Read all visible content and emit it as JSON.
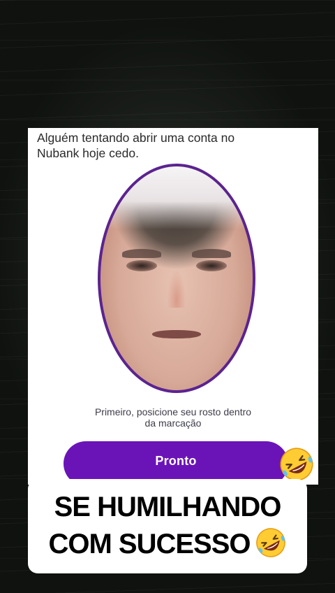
{
  "screenshot": {
    "caption_top": "Alguém tentando abrir uma conta no\nNubank hoje cedo.",
    "instruction": "Primeiro, posicione seu rosto dentro\nda marcação",
    "button_label": "Pronto"
  },
  "meme_caption": {
    "line1": "SE HUMILHANDO",
    "line2": "COM SUCESSO"
  },
  "icons": {
    "emoji": "rolling-on-the-floor-laughing-icon"
  },
  "colors": {
    "button": "#6a14b8",
    "oval_border": "#5b2390",
    "background": "#0f120f"
  }
}
